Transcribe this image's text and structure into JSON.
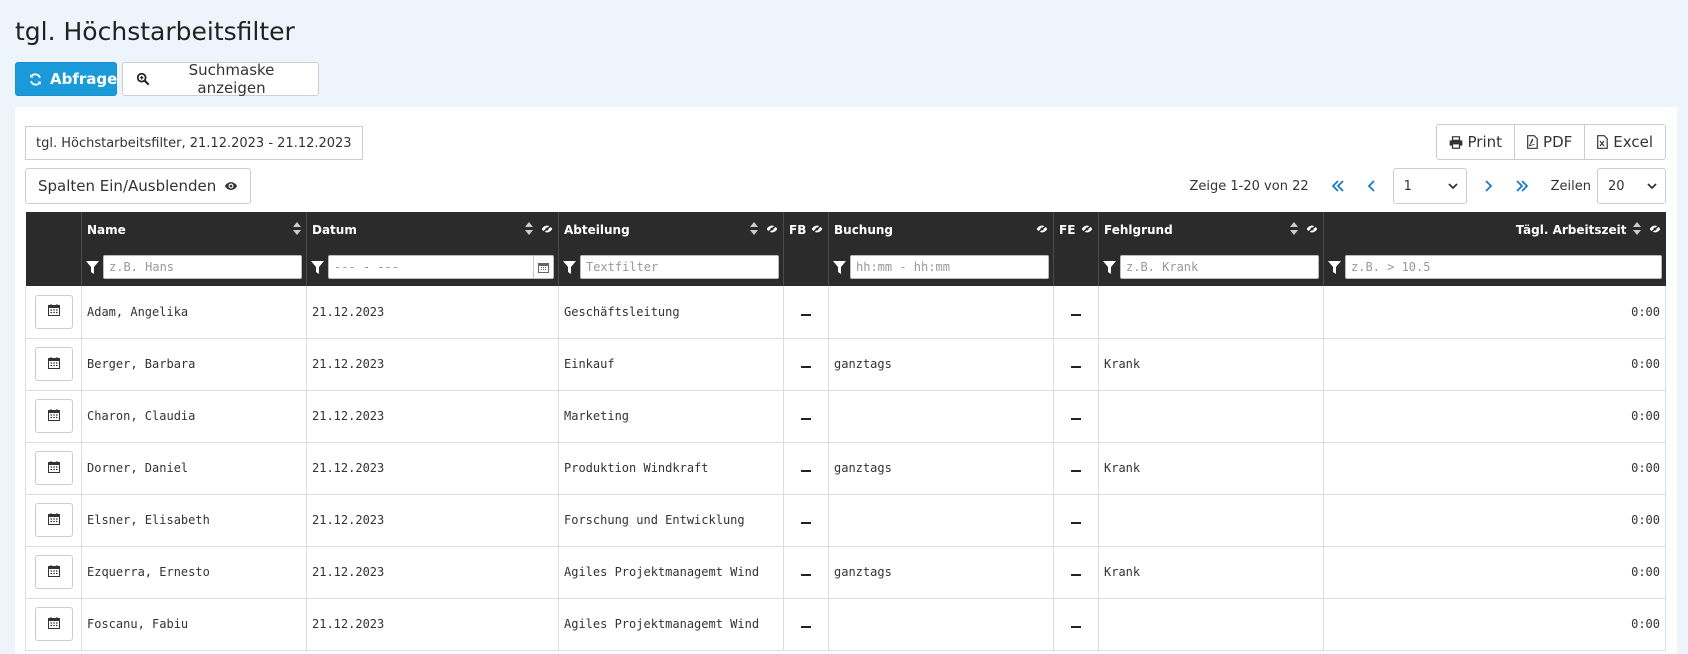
{
  "page": {
    "title": "tgl. Höchstarbeitsfilter"
  },
  "toolbar": {
    "query_label": "Abfrage",
    "search_label": "Suchmaske anzeigen"
  },
  "report": {
    "title": "tgl. Höchstarbeitsfilter, 21.12.2023 - 21.12.2023"
  },
  "export": {
    "print": "Print",
    "pdf": "PDF",
    "excel": "Excel"
  },
  "columns_toggle": {
    "label": "Spalten Ein/Ausblenden"
  },
  "pager": {
    "info": "Zeige 1-20 von 22",
    "page": "1",
    "rows_label": "Zeilen",
    "rows": "20"
  },
  "columns": [
    {
      "label": "Name",
      "placeholder": "z.B. Hans"
    },
    {
      "label": "Datum",
      "placeholder": "--- - ---"
    },
    {
      "label": "Abteilung",
      "placeholder": "Textfilter"
    },
    {
      "label": "FB"
    },
    {
      "label": "Buchung",
      "placeholder": "hh:mm - hh:mm"
    },
    {
      "label": "FE"
    },
    {
      "label": "Fehlgrund",
      "placeholder": "z.B. Krank"
    },
    {
      "label": "Tägl. Arbeitszeit",
      "placeholder": "z.B. > 10.5"
    }
  ],
  "rows": [
    {
      "name": "Adam, Angelika",
      "date": "21.12.2023",
      "dept": "Geschäftsleitung",
      "booking": "",
      "reason": "",
      "time": "0:00"
    },
    {
      "name": "Berger, Barbara",
      "date": "21.12.2023",
      "dept": "Einkauf",
      "booking": "ganztags",
      "reason": "Krank",
      "time": "0:00"
    },
    {
      "name": "Charon, Claudia",
      "date": "21.12.2023",
      "dept": "Marketing",
      "booking": "",
      "reason": "",
      "time": "0:00"
    },
    {
      "name": "Dorner, Daniel",
      "date": "21.12.2023",
      "dept": "Produktion Windkraft",
      "booking": "ganztags",
      "reason": "Krank",
      "time": "0:00"
    },
    {
      "name": "Elsner, Elisabeth",
      "date": "21.12.2023",
      "dept": "Forschung und Entwicklung",
      "booking": "",
      "reason": "",
      "time": "0:00"
    },
    {
      "name": "Ezquerra, Ernesto",
      "date": "21.12.2023",
      "dept": "Agiles Projektmanagemt Wind",
      "booking": "ganztags",
      "reason": "Krank",
      "time": "0:00"
    },
    {
      "name": "Foscanu, Fabiu",
      "date": "21.12.2023",
      "dept": "Agiles Projektmanagemt Wind",
      "booking": "",
      "reason": "",
      "time": "0:00"
    }
  ]
}
